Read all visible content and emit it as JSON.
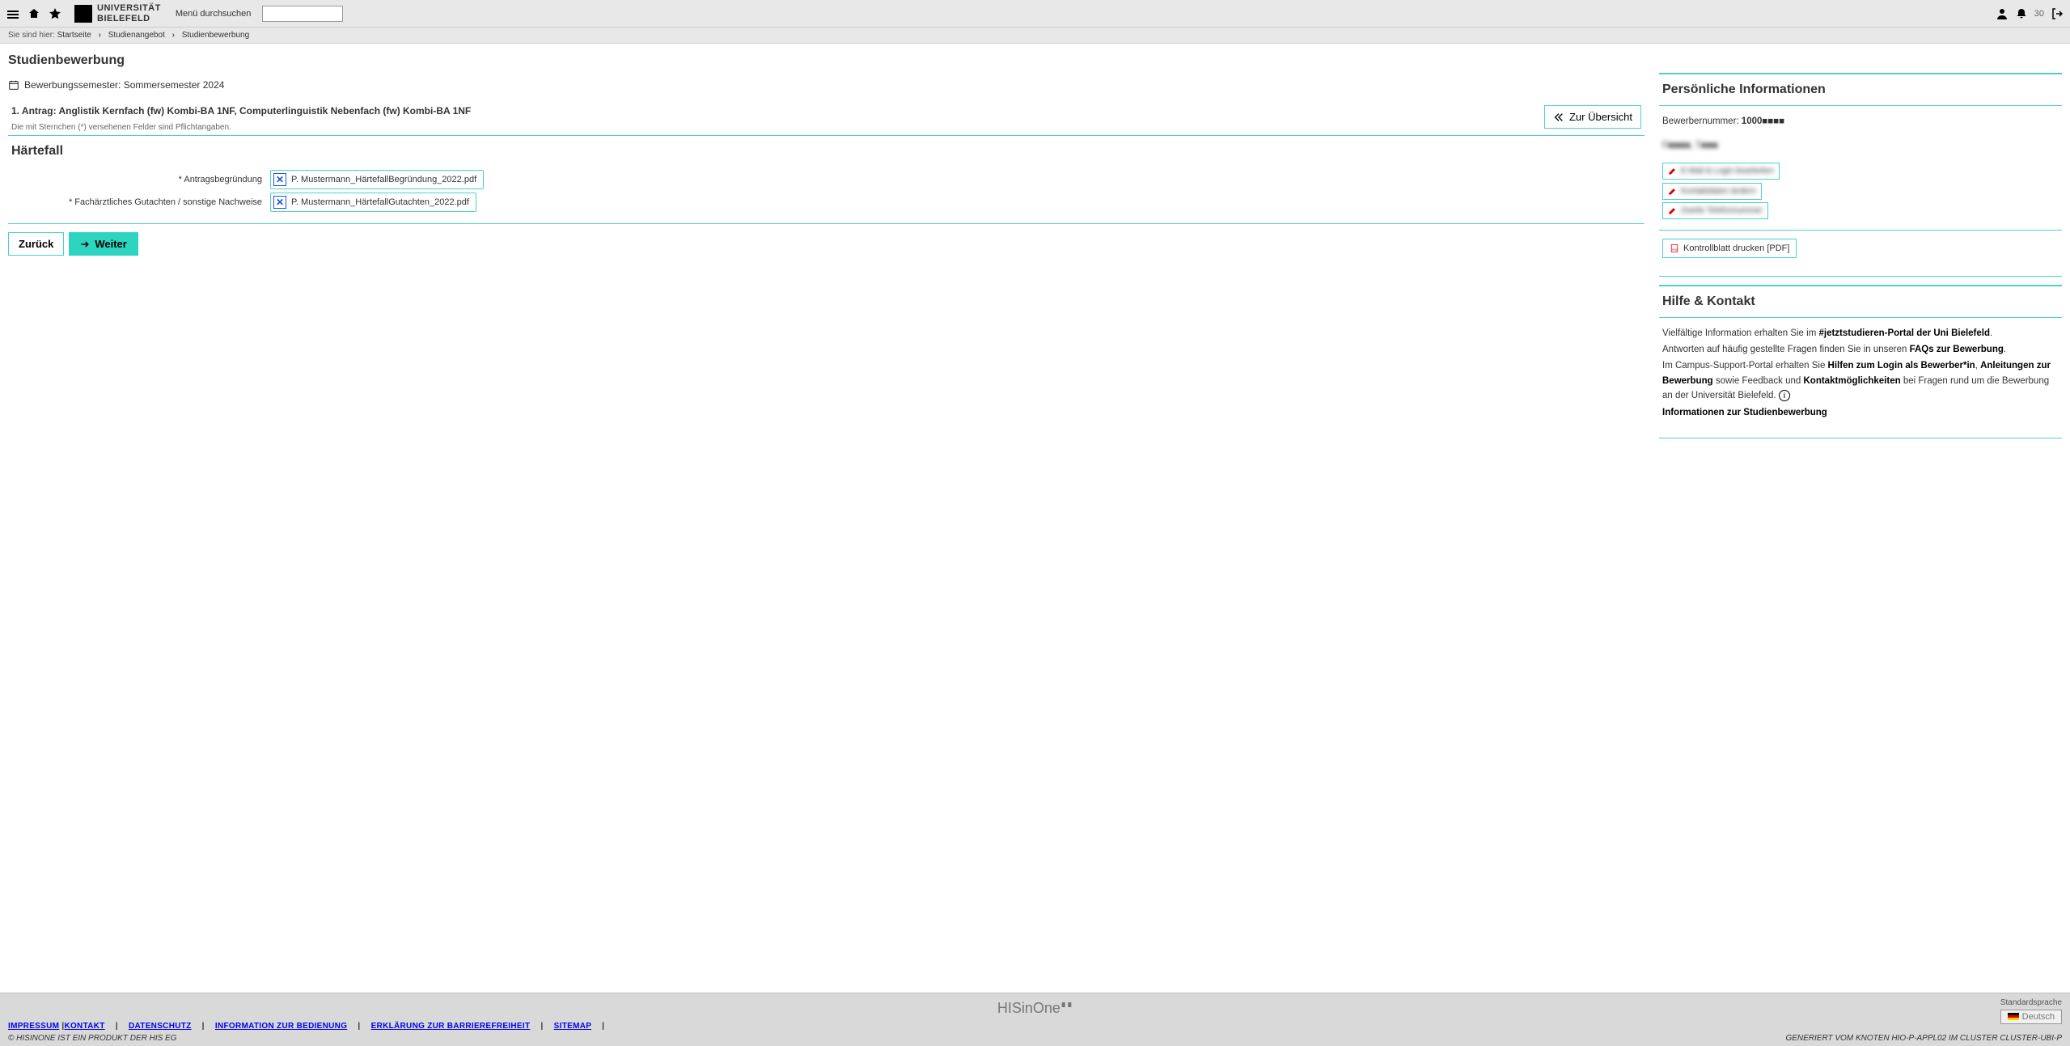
{
  "header": {
    "search_label": "Menü durchsuchen",
    "notification_count": "30",
    "logo_text_1": "UNIVERSITÄT",
    "logo_text_2": "BIELEFELD"
  },
  "breadcrumb": {
    "prefix": "Sie sind hier:",
    "items": [
      "Startseite",
      "Studienangebot",
      "Studienbewerbung"
    ]
  },
  "page": {
    "title": "Studienbewerbung",
    "semester_line": "Bewerbungssemester: Sommersemester 2024",
    "antrag_title": "1. Antrag: Anglistik Kernfach (fw) Kombi-BA 1NF, Computerlinguistik Nebenfach (fw) Kombi-BA 1NF",
    "required_note": "Die mit Sternchen (*) versehenen Felder sind Pflichtangaben.",
    "overview_btn": "Zur Übersicht",
    "haertefall_title": "Härtefall",
    "field1_label": "* Antragsbegründung",
    "field1_file": "P. Mustermann_HärtefallBegründung_2022.pdf",
    "field2_label": "* Fachärztliches Gutachten / sonstige Nachweise",
    "field2_file": "P. Mustermann_HärtefallGutachten_2022.pdf",
    "btn_back": "Zurück",
    "btn_next": "Weiter"
  },
  "personal": {
    "title": "Persönliche Informationen",
    "appnum_label": "Bewerbernummer: ",
    "appnum_value": "1000■■■■",
    "name": "F■■■■, T■■■",
    "pill1": "E-Mail & Login bearbeiten",
    "pill2": "Kontaktdaten ändern",
    "pill3": "Zweite Telefonnummer",
    "print_label": "Kontrollblatt drucken [PDF]"
  },
  "help": {
    "title": "Hilfe & Kontakt",
    "p1a": "Vielfältige Information erhalten Sie im ",
    "p1b": "#jetztstudieren-Portal der Uni Bielefeld",
    "p1c": ".",
    "p2a": "Antworten auf häufig gestellte Fragen finden Sie in unseren ",
    "p2b": "FAQs zur Bewerbung",
    "p2c": ".",
    "p3a": "Im Campus-Support-Portal erhalten Sie ",
    "p3b": "Hilfen zum Login als Bewerber*in",
    "p3c": ", ",
    "p3d": "Anleitungen zur Bewerbung",
    "p3e": " sowie Feedback und ",
    "p3f": "Kontaktmöglichkeiten",
    "p3g": " bei Fragen rund um die Bewerbung an der Universität Bielefeld. ",
    "p4": "Informationen zur Studienbewerbung"
  },
  "footer": {
    "brand": "HISinOne",
    "lang_label": "Standardsprache",
    "lang_value": "Deutsch",
    "links": [
      "IMPRESSUM",
      "KONTAKT",
      "DATENSCHUTZ",
      "INFORMATION ZUR BEDIENUNG",
      "ERKLÄRUNG ZUR BARRIEREFREIHEIT",
      "SITEMAP"
    ],
    "copyright": "© HISINONE IST EIN PRODUKT DER HIS EG",
    "generated": "GENERIERT VOM KNOTEN HIO-P-APPL02 IM CLUSTER CLUSTER-UBI-P"
  }
}
